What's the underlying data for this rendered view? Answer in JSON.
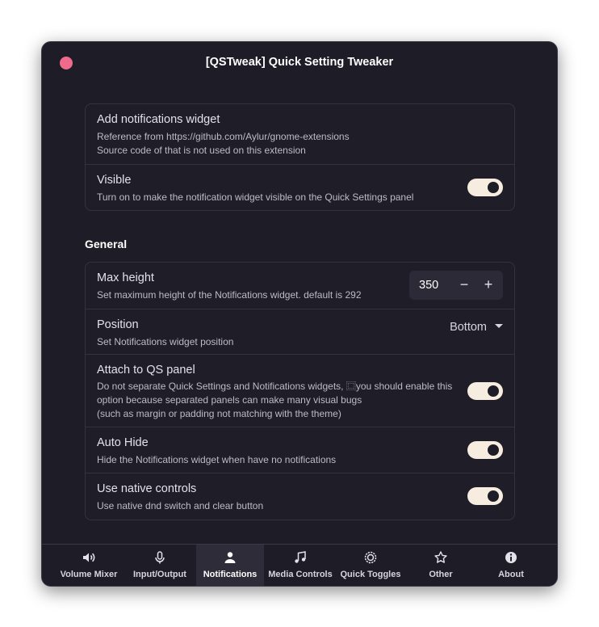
{
  "window": {
    "title": "[QSTweak] Quick Setting Tweaker"
  },
  "intro": {
    "add_title": "Add notifications widget",
    "add_sub1": "Reference from https://github.com/Aylur/gnome-extensions",
    "add_sub2": "Source code of that is not used on this extension",
    "visible_title": "Visible",
    "visible_sub": "Turn on to make the notification widget visible on the Quick Settings panel",
    "visible_on": true
  },
  "general": {
    "heading": "General",
    "max_height": {
      "title": "Max height",
      "sub": "Set maximum height of the Notifications widget. default is 292",
      "value": "350",
      "minus": "−",
      "plus": "+"
    },
    "position": {
      "title": "Position",
      "sub": "Set Notifications widget position",
      "value": "Bottom"
    },
    "attach": {
      "title": "Attach to QS panel",
      "sub1": "Do not separate Quick Settings and Notifications widgets, ⿴you should enable this",
      "sub2": "option because separated panels can make many visual bugs",
      "sub3": "(such as margin or padding not matching with the theme)",
      "on": true
    },
    "auto_hide": {
      "title": "Auto Hide",
      "sub": "Hide the Notifications widget when have no notifications",
      "on": true
    },
    "native": {
      "title": "Use native controls",
      "sub": "Use native dnd switch and clear button",
      "on": true
    }
  },
  "tabs": [
    {
      "label": "Volume Mixer",
      "icon": "speaker-icon"
    },
    {
      "label": "Input/Output",
      "icon": "microphone-icon"
    },
    {
      "label": "Notifications",
      "icon": "person-icon",
      "active": true
    },
    {
      "label": "Media Controls",
      "icon": "music-note-icon"
    },
    {
      "label": "Quick Toggles",
      "icon": "toggles-icon"
    },
    {
      "label": "Other",
      "icon": "star-icon"
    },
    {
      "label": "About",
      "icon": "info-icon"
    }
  ],
  "colors": {
    "background": "#1e1c27",
    "toggle_on": "#f6ecdf",
    "close": "#f06a8a"
  }
}
